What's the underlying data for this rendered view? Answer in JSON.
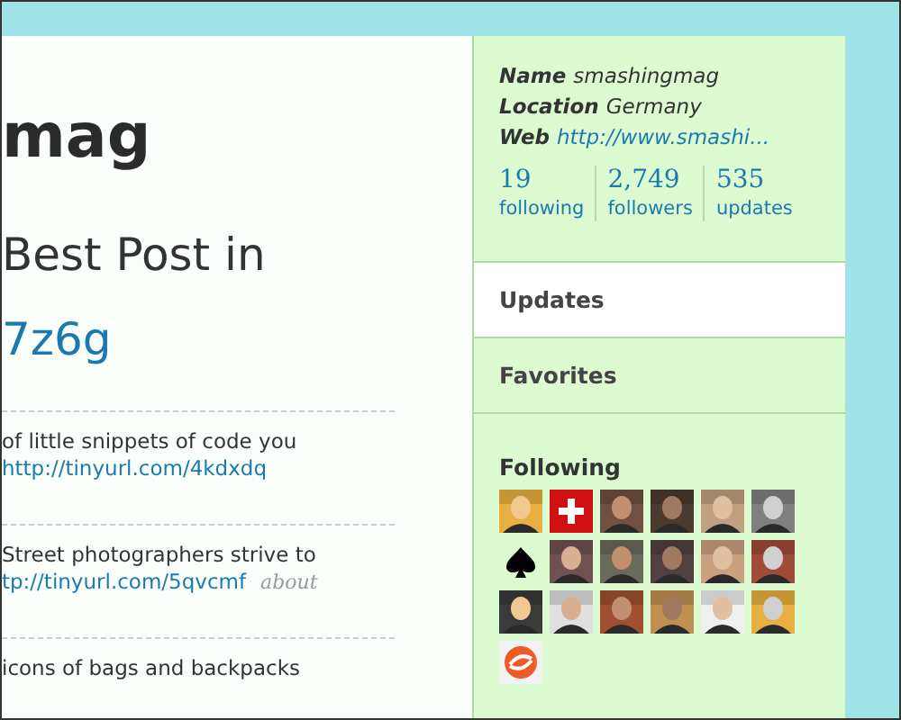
{
  "main": {
    "heading": "mag",
    "tweet_title": "Best Post in",
    "tweet_link": "7z6g",
    "tweets": [
      {
        "text": "of little snippets of code you",
        "link": "http://tinyurl.com/4kdxdq"
      },
      {
        "text": "Street photographers strive to",
        "link": "tp://tinyurl.com/5qvcmf",
        "meta": "about"
      },
      {
        "text": "icons of bags and backpacks"
      }
    ]
  },
  "sidebar": {
    "profile": [
      {
        "label": "Name",
        "value": "smashingmag",
        "kind": "text"
      },
      {
        "label": "Location",
        "value": "Germany",
        "kind": "text"
      },
      {
        "label": "Web",
        "value": "http://www.smashi...",
        "kind": "link"
      }
    ],
    "stats": [
      {
        "count": "19",
        "label": "following"
      },
      {
        "count": "2,749",
        "label": "followers"
      },
      {
        "count": "535",
        "label": "updates"
      }
    ],
    "menu": [
      {
        "label": "Updates",
        "selected": true
      },
      {
        "label": "Favorites",
        "selected": false
      }
    ],
    "following_title": "Following",
    "following": [
      {
        "kind": "picture"
      },
      {
        "kind": "flag"
      },
      {
        "kind": "picture"
      },
      {
        "kind": "picture"
      },
      {
        "kind": "picture"
      },
      {
        "kind": "picture"
      },
      {
        "kind": "spade"
      },
      {
        "kind": "picture"
      },
      {
        "kind": "picture"
      },
      {
        "kind": "picture"
      },
      {
        "kind": "picture"
      },
      {
        "kind": "picture"
      },
      {
        "kind": "picture"
      },
      {
        "kind": "picture"
      },
      {
        "kind": "picture"
      },
      {
        "kind": "picture"
      },
      {
        "kind": "picture"
      },
      {
        "kind": "picture"
      },
      {
        "kind": "logo"
      }
    ]
  }
}
